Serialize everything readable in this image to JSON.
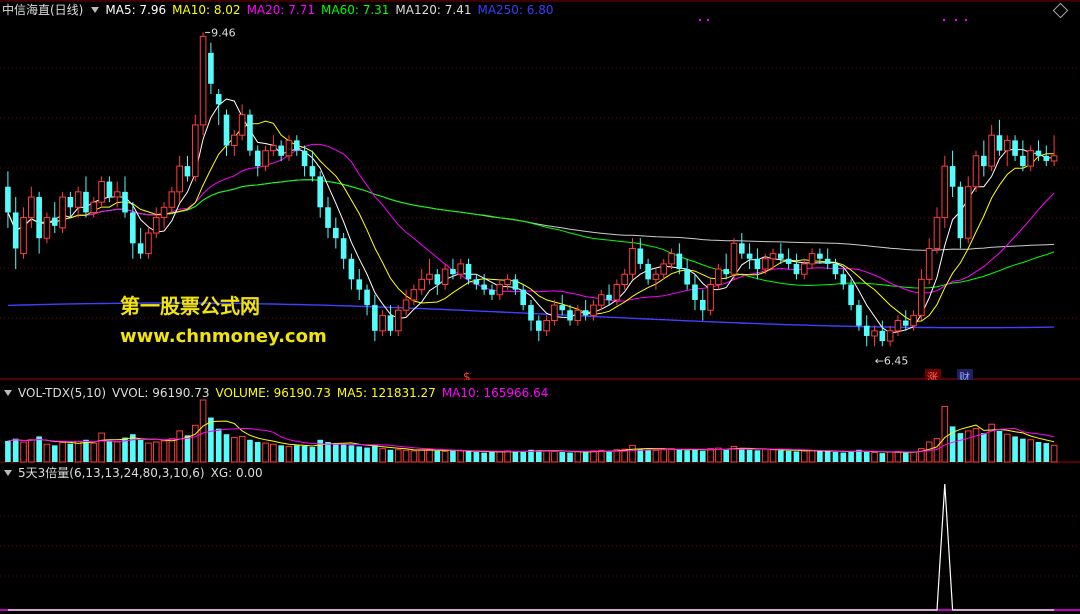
{
  "main_header": {
    "title": "中信海直(日线)",
    "ma5": "MA5: 7.96",
    "ma10": "MA10: 8.02",
    "ma20": "MA20: 7.71",
    "ma60": "MA60: 7.31",
    "ma120": "MA120: 7.41",
    "ma250": "MA250: 6.80"
  },
  "vol_header": {
    "name": "VOL-TDX(5,10)",
    "vvol": "VVOL: 96190.73",
    "volume": "VOLUME: 96190.73",
    "ma5": "MA5: 121831.27",
    "ma10": "MA10: 165966.64"
  },
  "ind_header": {
    "name": "5天3倍量(6,13,13,24,80,3,10,6)",
    "xg": "XG: 0.00"
  },
  "watermark": {
    "line1": "第一股票公式网",
    "line2": "www.chnmoney.com"
  },
  "markers": {
    "dollar": "$",
    "zhang": "涨",
    "cai": "财"
  },
  "colors": {
    "up": "#ff3c3c",
    "down": "#54fcfc",
    "ma5": "#ffffff",
    "ma10": "#ffff00",
    "ma20": "#ff00ff",
    "ma60": "#00ff00",
    "ma120": "#cccccc",
    "ma250": "#4040ff",
    "grid": "#7a0000"
  },
  "chart_data": [
    {
      "type": "candlestick",
      "title": "中信海直(日线)",
      "price_range": [
        6.2,
        9.6
      ],
      "grid": true,
      "annotations": [
        {
          "label": "9.46",
          "value": 9.46
        },
        {
          "label": "6.45",
          "value": 6.45
        }
      ],
      "ohlc": [
        [
          8.0,
          8.15,
          7.6,
          7.75
        ],
        [
          7.75,
          7.9,
          7.2,
          7.4
        ],
        [
          7.35,
          7.8,
          7.3,
          7.7
        ],
        [
          7.7,
          8.0,
          7.6,
          7.9
        ],
        [
          7.9,
          7.95,
          7.35,
          7.5
        ],
        [
          7.5,
          7.75,
          7.45,
          7.7
        ],
        [
          7.7,
          7.85,
          7.55,
          7.62
        ],
        [
          7.6,
          7.95,
          7.55,
          7.9
        ],
        [
          7.9,
          7.95,
          7.7,
          7.8
        ],
        [
          7.8,
          8.0,
          7.7,
          7.95
        ],
        [
          7.95,
          8.1,
          7.7,
          7.75
        ],
        [
          7.75,
          7.9,
          7.7,
          7.85
        ],
        [
          7.85,
          8.1,
          7.8,
          8.05
        ],
        [
          8.05,
          8.1,
          7.85,
          7.9
        ],
        [
          7.9,
          8.05,
          7.8,
          7.95
        ],
        [
          7.95,
          8.1,
          7.7,
          7.75
        ],
        [
          7.75,
          7.85,
          7.3,
          7.45
        ],
        [
          7.45,
          7.6,
          7.3,
          7.35
        ],
        [
          7.35,
          7.6,
          7.3,
          7.55
        ],
        [
          7.55,
          7.8,
          7.5,
          7.7
        ],
        [
          7.7,
          7.85,
          7.6,
          7.8
        ],
        [
          7.8,
          8.0,
          7.75,
          7.95
        ],
        [
          7.95,
          8.3,
          7.85,
          8.2
        ],
        [
          8.2,
          8.3,
          8.05,
          8.1
        ],
        [
          8.1,
          8.7,
          8.05,
          8.6
        ],
        [
          8.6,
          9.5,
          8.5,
          9.46
        ],
        [
          9.3,
          9.4,
          8.9,
          9.0
        ],
        [
          8.9,
          8.95,
          8.6,
          8.8
        ],
        [
          8.7,
          8.75,
          8.3,
          8.4
        ],
        [
          8.4,
          8.55,
          8.3,
          8.5
        ],
        [
          8.5,
          8.8,
          8.45,
          8.7
        ],
        [
          8.7,
          8.75,
          8.3,
          8.35
        ],
        [
          8.35,
          8.4,
          8.1,
          8.2
        ],
        [
          8.2,
          8.4,
          8.15,
          8.35
        ],
        [
          8.35,
          8.5,
          8.3,
          8.4
        ],
        [
          8.4,
          8.45,
          8.25,
          8.3
        ],
        [
          8.3,
          8.5,
          8.25,
          8.45
        ],
        [
          8.45,
          8.5,
          8.3,
          8.35
        ],
        [
          8.35,
          8.4,
          8.1,
          8.2
        ],
        [
          8.2,
          8.35,
          8.05,
          8.1
        ],
        [
          8.1,
          8.15,
          7.7,
          7.8
        ],
        [
          7.8,
          7.9,
          7.5,
          7.6
        ],
        [
          7.6,
          7.7,
          7.4,
          7.5
        ],
        [
          7.5,
          7.55,
          7.2,
          7.3
        ],
        [
          7.3,
          7.35,
          7.0,
          7.1
        ],
        [
          7.1,
          7.2,
          6.9,
          7.0
        ],
        [
          7.0,
          7.05,
          6.75,
          6.85
        ],
        [
          6.85,
          6.95,
          6.5,
          6.6
        ],
        [
          6.6,
          6.8,
          6.55,
          6.75
        ],
        [
          6.75,
          6.85,
          6.55,
          6.6
        ],
        [
          6.6,
          6.85,
          6.55,
          6.8
        ],
        [
          6.8,
          7.0,
          6.75,
          6.9
        ],
        [
          6.9,
          7.05,
          6.85,
          7.0
        ],
        [
          7.0,
          7.2,
          6.95,
          7.1
        ],
        [
          7.1,
          7.3,
          7.05,
          7.15
        ],
        [
          7.15,
          7.2,
          6.95,
          7.05
        ],
        [
          7.05,
          7.25,
          7.0,
          7.2
        ],
        [
          7.2,
          7.3,
          7.1,
          7.15
        ],
        [
          7.15,
          7.3,
          7.1,
          7.25
        ],
        [
          7.25,
          7.3,
          7.05,
          7.1
        ],
        [
          7.1,
          7.15,
          7.0,
          7.05
        ],
        [
          7.05,
          7.15,
          6.95,
          7.0
        ],
        [
          7.0,
          7.05,
          6.9,
          6.95
        ],
        [
          6.95,
          7.1,
          6.9,
          7.05
        ],
        [
          7.05,
          7.15,
          7.0,
          7.1
        ],
        [
          7.1,
          7.15,
          6.95,
          7.0
        ],
        [
          7.0,
          7.05,
          6.8,
          6.85
        ],
        [
          6.85,
          6.9,
          6.6,
          6.7
        ],
        [
          6.7,
          6.75,
          6.5,
          6.6
        ],
        [
          6.6,
          6.75,
          6.55,
          6.7
        ],
        [
          6.7,
          6.9,
          6.65,
          6.85
        ],
        [
          6.85,
          6.95,
          6.75,
          6.8
        ],
        [
          6.8,
          6.85,
          6.65,
          6.7
        ],
        [
          6.7,
          6.85,
          6.65,
          6.8
        ],
        [
          6.8,
          6.9,
          6.7,
          6.75
        ],
        [
          6.75,
          6.9,
          6.7,
          6.85
        ],
        [
          6.85,
          7.0,
          6.8,
          6.95
        ],
        [
          6.95,
          7.05,
          6.85,
          6.9
        ],
        [
          6.9,
          7.1,
          6.85,
          7.05
        ],
        [
          7.05,
          7.2,
          7.0,
          7.15
        ],
        [
          7.15,
          7.5,
          7.1,
          7.4
        ],
        [
          7.4,
          7.5,
          7.2,
          7.25
        ],
        [
          7.25,
          7.3,
          7.05,
          7.1
        ],
        [
          7.1,
          7.2,
          7.0,
          7.15
        ],
        [
          7.15,
          7.3,
          7.1,
          7.25
        ],
        [
          7.25,
          7.4,
          7.2,
          7.35
        ],
        [
          7.35,
          7.45,
          7.15,
          7.2
        ],
        [
          7.2,
          7.3,
          7.0,
          7.05
        ],
        [
          7.05,
          7.15,
          6.8,
          6.9
        ],
        [
          6.9,
          7.0,
          6.7,
          6.8
        ],
        [
          6.8,
          7.1,
          6.75,
          7.05
        ],
        [
          7.05,
          7.25,
          7.0,
          7.2
        ],
        [
          7.2,
          7.35,
          7.1,
          7.15
        ],
        [
          7.15,
          7.5,
          7.1,
          7.45
        ],
        [
          7.45,
          7.55,
          7.3,
          7.35
        ],
        [
          7.35,
          7.45,
          7.2,
          7.3
        ],
        [
          7.3,
          7.4,
          7.1,
          7.2
        ],
        [
          7.2,
          7.35,
          7.15,
          7.3
        ],
        [
          7.3,
          7.4,
          7.2,
          7.35
        ],
        [
          7.35,
          7.45,
          7.25,
          7.3
        ],
        [
          7.3,
          7.4,
          7.2,
          7.25
        ],
        [
          7.25,
          7.35,
          7.1,
          7.15
        ],
        [
          7.15,
          7.3,
          7.1,
          7.25
        ],
        [
          7.25,
          7.4,
          7.2,
          7.35
        ],
        [
          7.35,
          7.4,
          7.25,
          7.3
        ],
        [
          7.3,
          7.4,
          7.2,
          7.25
        ],
        [
          7.25,
          7.3,
          7.1,
          7.15
        ],
        [
          7.15,
          7.2,
          7.0,
          7.05
        ],
        [
          7.05,
          7.1,
          6.8,
          6.85
        ],
        [
          6.85,
          6.9,
          6.6,
          6.65
        ],
        [
          6.65,
          6.75,
          6.45,
          6.55
        ],
        [
          6.55,
          6.65,
          6.45,
          6.6
        ],
        [
          6.6,
          6.7,
          6.45,
          6.5
        ],
        [
          6.5,
          6.65,
          6.45,
          6.6
        ],
        [
          6.6,
          6.75,
          6.55,
          6.7
        ],
        [
          6.7,
          6.8,
          6.6,
          6.65
        ],
        [
          6.65,
          6.8,
          6.6,
          6.75
        ],
        [
          6.75,
          7.2,
          6.7,
          7.1
        ],
        [
          7.1,
          7.5,
          7.05,
          7.4
        ],
        [
          7.4,
          7.8,
          7.35,
          7.7
        ],
        [
          7.7,
          8.3,
          7.6,
          8.2
        ],
        [
          8.2,
          8.35,
          7.9,
          8.0
        ],
        [
          8.0,
          8.05,
          7.4,
          7.5
        ],
        [
          7.5,
          8.1,
          7.45,
          8.0
        ],
        [
          8.0,
          8.35,
          7.95,
          8.3
        ],
        [
          8.3,
          8.45,
          8.1,
          8.2
        ],
        [
          8.2,
          8.6,
          8.15,
          8.5
        ],
        [
          8.5,
          8.65,
          8.3,
          8.35
        ],
        [
          8.35,
          8.5,
          8.2,
          8.45
        ],
        [
          8.45,
          8.5,
          8.25,
          8.3
        ],
        [
          8.3,
          8.45,
          8.15,
          8.2
        ],
        [
          8.2,
          8.4,
          8.15,
          8.35
        ],
        [
          8.35,
          8.45,
          8.25,
          8.3
        ],
        [
          8.3,
          8.4,
          8.2,
          8.25
        ],
        [
          8.25,
          8.5,
          8.2,
          8.3
        ]
      ],
      "moving_averages": [
        {
          "name": "MA5",
          "value": 7.96
        },
        {
          "name": "MA10",
          "value": 8.02
        },
        {
          "name": "MA20",
          "value": 7.71
        },
        {
          "name": "MA60",
          "value": 7.31
        },
        {
          "name": "MA120",
          "value": 7.41
        },
        {
          "name": "MA250",
          "value": 6.8
        }
      ]
    },
    {
      "type": "bar",
      "title": "VOL-TDX(5,10)",
      "ylim": [
        0,
        600000
      ],
      "values": [
        190000,
        210000,
        180000,
        200000,
        230000,
        160000,
        150000,
        175000,
        165000,
        185000,
        200000,
        170000,
        260000,
        190000,
        180000,
        220000,
        250000,
        200000,
        170000,
        180000,
        190000,
        210000,
        280000,
        240000,
        330000,
        560000,
        400000,
        300000,
        250000,
        220000,
        230000,
        200000,
        180000,
        170000,
        160000,
        150000,
        140000,
        150000,
        145000,
        135000,
        200000,
        180000,
        170000,
        160000,
        150000,
        140000,
        130000,
        150000,
        120000,
        110000,
        110000,
        105000,
        100000,
        110000,
        115000,
        100000,
        95000,
        105000,
        100000,
        95000,
        90000,
        85000,
        90000,
        95000,
        100000,
        90000,
        95000,
        110000,
        105000,
        100000,
        95000,
        90000,
        85000,
        95000,
        90000,
        100000,
        105000,
        95000,
        110000,
        115000,
        150000,
        120000,
        110000,
        105000,
        110000,
        120000,
        115000,
        105000,
        110000,
        100000,
        120000,
        125000,
        115000,
        140000,
        120000,
        110000,
        105000,
        115000,
        110000,
        105000,
        100000,
        95000,
        100000,
        105000,
        100000,
        95000,
        90000,
        85000,
        100000,
        110000,
        90000,
        85000,
        80000,
        90000,
        95000,
        85000,
        90000,
        120000,
        180000,
        210000,
        500000,
        320000,
        260000,
        280000,
        300000,
        260000,
        340000,
        280000,
        250000,
        230000,
        210000,
        200000,
        180000,
        170000,
        150000
      ],
      "ma5_label": 121831.27,
      "ma10_label": 165966.64,
      "current_volume": 96190.73
    },
    {
      "type": "line",
      "title": "5天3倍量(6,13,13,24,80,3,10,6)",
      "ylim": [
        0,
        1
      ],
      "values": [
        0,
        0,
        0,
        0,
        0,
        0,
        0,
        0,
        0,
        0,
        0,
        0,
        0,
        0,
        0,
        0,
        0,
        0,
        0,
        0,
        0,
        0,
        0,
        0,
        0,
        0,
        0,
        0,
        0,
        0,
        0,
        0,
        0,
        0,
        0,
        0,
        0,
        0,
        0,
        0,
        0,
        0,
        0,
        0,
        0,
        0,
        0,
        0,
        0,
        0,
        0,
        0,
        0,
        0,
        0,
        0,
        0,
        0,
        0,
        0,
        0,
        0,
        0,
        0,
        0,
        0,
        0,
        0,
        0,
        0,
        0,
        0,
        0,
        0,
        0,
        0,
        0,
        0,
        0,
        0,
        0,
        0,
        0,
        0,
        0,
        0,
        0,
        0,
        0,
        0,
        0,
        0,
        0,
        0,
        0,
        0,
        0,
        0,
        0,
        0,
        0,
        0,
        0,
        0,
        0,
        0,
        0,
        0,
        0,
        0,
        0,
        0,
        0,
        0,
        0,
        0,
        0,
        0,
        0,
        0,
        1,
        0,
        0,
        0,
        0,
        0,
        0,
        0,
        0,
        0,
        0,
        0,
        0,
        0,
        0
      ],
      "current_xg": 0.0
    }
  ]
}
